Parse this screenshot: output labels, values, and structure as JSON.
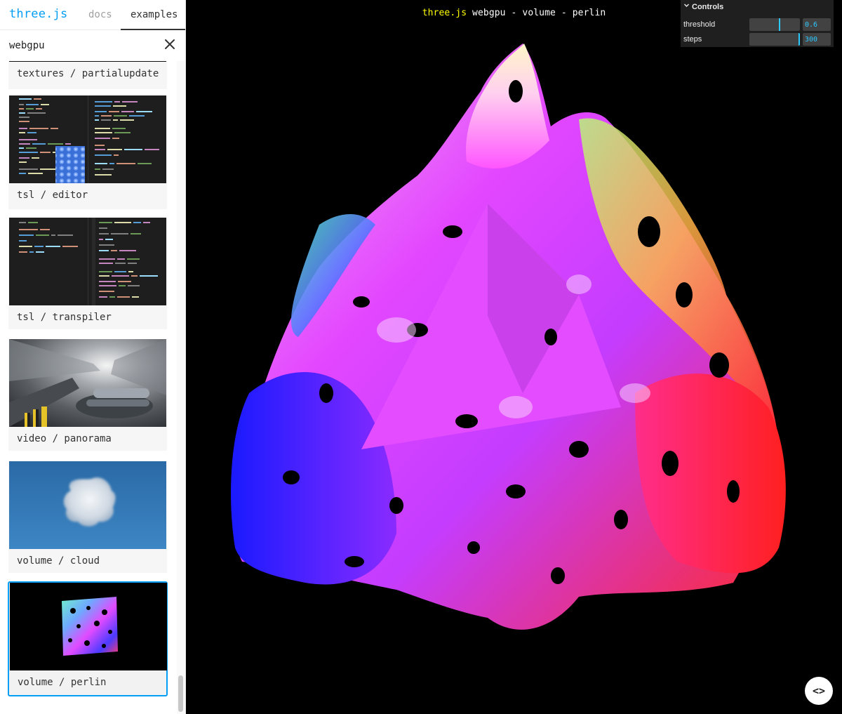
{
  "header": {
    "brand": "three.js",
    "tabs": [
      {
        "label": "docs",
        "active": false
      },
      {
        "label": "examples",
        "active": true
      }
    ]
  },
  "search": {
    "value": "webgpu",
    "clear_icon": "close-icon"
  },
  "examples": [
    {
      "label": "textures / partialupdate",
      "thumb": "partial"
    },
    {
      "label": "tsl / editor",
      "thumb": "code-editor"
    },
    {
      "label": "tsl / transpiler",
      "thumb": "code-transpiler"
    },
    {
      "label": "video / panorama",
      "thumb": "tunnel-photo"
    },
    {
      "label": "volume / cloud",
      "thumb": "cloud-render"
    },
    {
      "label": "volume / perlin",
      "thumb": "perlin-render",
      "selected": true
    }
  ],
  "viewport": {
    "title_highlight": "three.js",
    "title_rest": " webgpu - volume - perlin"
  },
  "controls": {
    "title": "Controls",
    "collapse_icon": "chevron-down-icon",
    "rows": [
      {
        "name": "threshold",
        "value": "0.6",
        "fill": 0.6
      },
      {
        "name": "steps",
        "value": "300",
        "fill": 1.0
      }
    ]
  },
  "code_button": {
    "label": "<>",
    "icon": "code-icon"
  },
  "colors": {
    "brand": "#049ef4",
    "slider_accent": "#2cc9ff",
    "title_highlight": "#ffff00"
  }
}
